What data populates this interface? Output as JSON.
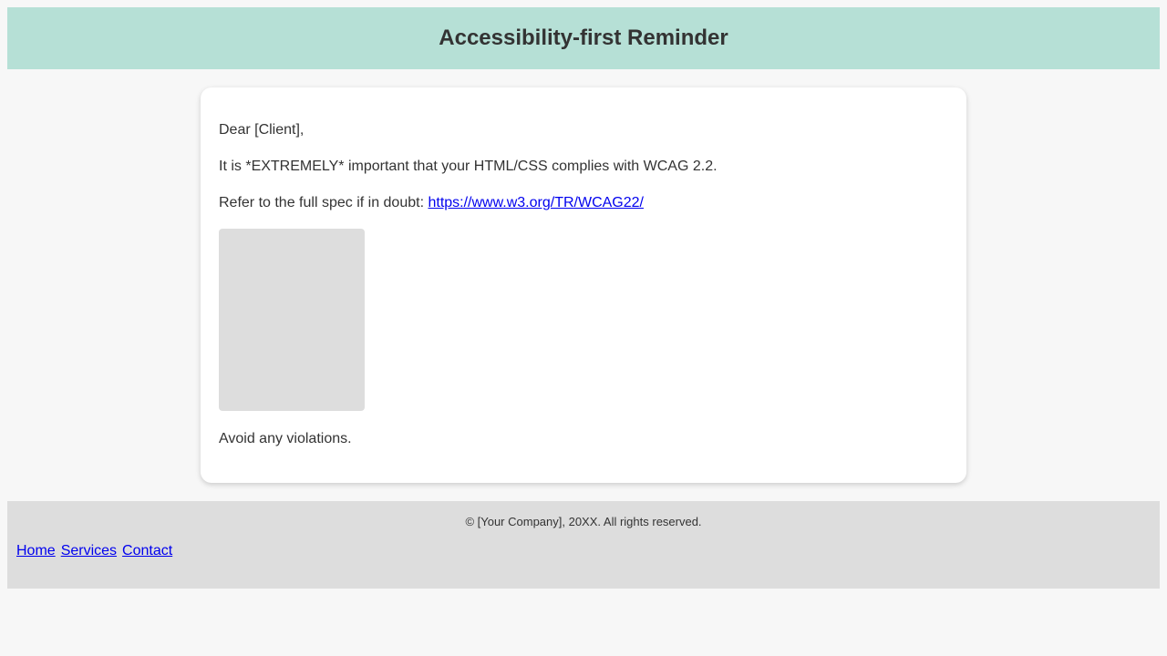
{
  "header": {
    "title": "Accessibility-first Reminder"
  },
  "letter": {
    "greeting": "Dear [Client],",
    "importance": "It is *EXTREMELY* important that your HTML/CSS complies with WCAG 2.2.",
    "spec_prefix": "Refer to the full spec if in doubt: ",
    "spec_link": "https://www.w3.org/TR/WCAG22/",
    "closing": "Avoid any violations."
  },
  "footer": {
    "copyright": "© [Your Company], 20XX. All rights reserved.",
    "nav": [
      {
        "label": "Home"
      },
      {
        "label": "Services"
      },
      {
        "label": "Contact"
      }
    ]
  },
  "colors": {
    "header_bg": "#b6e0d6",
    "page_bg": "#f7f7f7",
    "footer_bg": "#dddddd",
    "link": "#0000ee",
    "text": "#333333"
  }
}
